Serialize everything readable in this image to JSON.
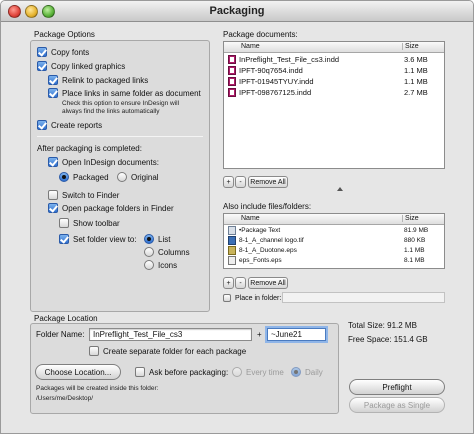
{
  "window": {
    "title": "Packaging"
  },
  "package_options": {
    "title": "Package Options",
    "copy_fonts": {
      "label": "Copy fonts",
      "checked": true
    },
    "copy_linked_graphics": {
      "label": "Copy linked graphics",
      "checked": true
    },
    "relink": {
      "label": "Relink to packaged links",
      "checked": true
    },
    "place_links": {
      "label": "Place links in same folder as document",
      "checked": true
    },
    "place_links_note_1": "Check this option to ensure InDesign will",
    "place_links_note_2": "always find the links automatically",
    "create_reports": {
      "label": "Create reports",
      "checked": true
    }
  },
  "after_packaging": {
    "title": "After packaging is completed:",
    "open_indesign": {
      "label": "Open InDesign documents:",
      "checked": true
    },
    "packaged": "Packaged",
    "original": "Original",
    "switch_finder": {
      "label": "Switch to Finder",
      "checked": false
    },
    "open_folders": {
      "label": "Open package folders in Finder",
      "checked": true
    },
    "show_toolbar": {
      "label": "Show toolbar",
      "checked": false
    },
    "set_folder_view": {
      "label": "Set folder view to:",
      "checked": true
    },
    "view_list": "List",
    "view_columns": "Columns",
    "view_icons": "Icons"
  },
  "package_documents": {
    "title": "Package documents:",
    "col_name": "Name",
    "col_size": "Size",
    "rows": [
      {
        "name": "InPreflight_Test_File_cs3.indd",
        "size": "3.6 MB",
        "icon": "indd-file-icon"
      },
      {
        "name": "IPFT-90q7654.indd",
        "size": "1.1 MB",
        "icon": "indd-file-icon"
      },
      {
        "name": "IPFT-01945TYUY.indd",
        "size": "1.1 MB",
        "icon": "indd-file-icon"
      },
      {
        "name": "IPFT-098767125.indd",
        "size": "2.7 MB",
        "icon": "indd-file-icon"
      }
    ],
    "add": "+",
    "remove": "-",
    "remove_all": "Remove All"
  },
  "also_include": {
    "title": "Also include files/folders:",
    "col_name": "Name",
    "col_size": "Size",
    "rows": [
      {
        "name": "•Package Text",
        "size": "81.9 MB",
        "icon": "package-folder-icon"
      },
      {
        "name": "8-1_A_channel logo.tif",
        "size": "880 KB",
        "icon": "tif-file-icon"
      },
      {
        "name": "8-1_A_Duotone.eps",
        "size": "1.1 MB",
        "icon": "eps-file-icon"
      },
      {
        "name": "eps_Fonts.eps",
        "size": "8.1 MB",
        "icon": "font-file-icon"
      }
    ],
    "add": "+",
    "remove": "-",
    "remove_all": "Remove All",
    "place_in_folder": {
      "label": "Place in folder:",
      "checked": false,
      "value": ""
    }
  },
  "package_location": {
    "title": "Package Location",
    "folder_name_label": "Folder Name:",
    "folder_name": "InPreflight_Test_File_cs3",
    "plus": "+",
    "suffix": "~June21",
    "create_separate": {
      "label": "Create separate folder for each package",
      "checked": false
    },
    "choose_location": "Choose Location...",
    "ask_before": {
      "label": "Ask before packaging:",
      "checked": false
    },
    "every_time": "Every time",
    "daily": "Daily",
    "created_note": "Packages will be created inside this folder:",
    "path": "/Users/me/Desktop/"
  },
  "summary": {
    "total_size": "Total Size:  91.2 MB",
    "free_space": "Free Space:  151.4 GB"
  },
  "buttons": {
    "preflight": "Preflight",
    "package_single": "Package as Single"
  },
  "colors": {
    "accent": "#2f6fcf",
    "window_bg": "#e6e6e6",
    "traffic_red": "#e0443b",
    "traffic_yellow": "#e6b430",
    "traffic_green": "#5bb33a"
  }
}
